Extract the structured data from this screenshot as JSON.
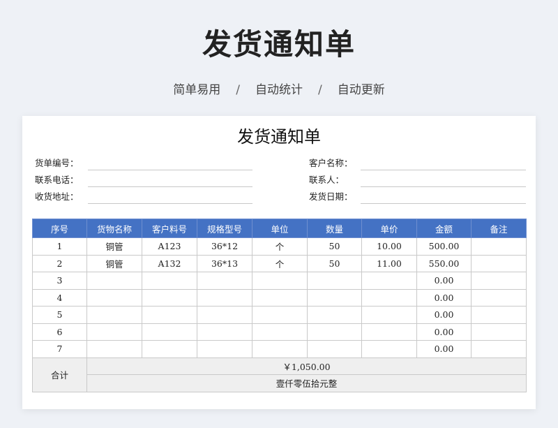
{
  "banner": {
    "title": "发货通知单",
    "features": [
      "简单易用",
      "自动统计",
      "自动更新"
    ],
    "separator": "/"
  },
  "document": {
    "title": "发货通知单",
    "fields_left": [
      {
        "label": "货单编号："
      },
      {
        "label": "联系电话："
      },
      {
        "label": "收货地址："
      }
    ],
    "fields_right": [
      {
        "label": "客户名称："
      },
      {
        "label": "联系人："
      },
      {
        "label": "发货日期："
      }
    ]
  },
  "table": {
    "headers": [
      "序号",
      "货物名称",
      "客户料号",
      "规格型号",
      "单位",
      "数量",
      "单价",
      "金额",
      "备注"
    ],
    "rows": [
      [
        "1",
        "铜管",
        "A123",
        "36*12",
        "个",
        "50",
        "10.00",
        "500.00",
        ""
      ],
      [
        "2",
        "铜管",
        "A132",
        "36*13",
        "个",
        "50",
        "11.00",
        "550.00",
        ""
      ],
      [
        "3",
        "",
        "",
        "",
        "",
        "",
        "",
        "0.00",
        ""
      ],
      [
        "4",
        "",
        "",
        "",
        "",
        "",
        "",
        "0.00",
        ""
      ],
      [
        "5",
        "",
        "",
        "",
        "",
        "",
        "",
        "0.00",
        ""
      ],
      [
        "6",
        "",
        "",
        "",
        "",
        "",
        "",
        "0.00",
        ""
      ],
      [
        "7",
        "",
        "",
        "",
        "",
        "",
        "",
        "0.00",
        ""
      ]
    ],
    "total_label": "合计",
    "total_amount": "￥1,050.00",
    "total_in_words": "壹仟零伍拾元整"
  },
  "colors": {
    "header_bg": "#4472c4",
    "page_bg": "#eef1f6"
  }
}
